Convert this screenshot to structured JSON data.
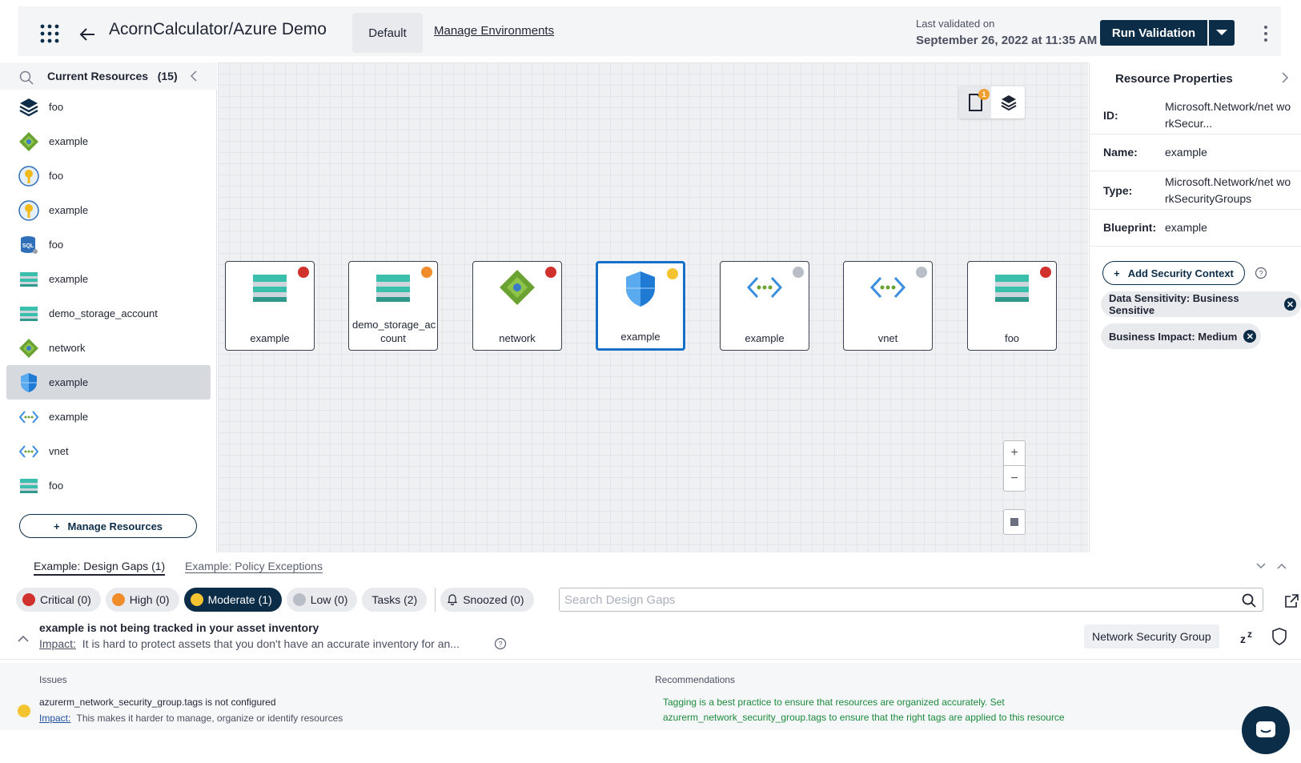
{
  "header": {
    "title": "AcornCalculator/Azure Demo",
    "env_tab": "Default",
    "manage_envs": "Manage Environments",
    "last_validated_label": "Last validated on",
    "last_validated_date": "September 26, 2022 at 11:35 AM",
    "run_validation": "Run Validation"
  },
  "sidebar": {
    "title": "Current Resources",
    "count": "(15)",
    "items": [
      {
        "label": "foo",
        "icon": "layers-icon"
      },
      {
        "label": "example",
        "icon": "network-diamond-icon"
      },
      {
        "label": "foo",
        "icon": "key-vault-icon"
      },
      {
        "label": "example",
        "icon": "key-vault-icon"
      },
      {
        "label": "foo",
        "icon": "sql-icon"
      },
      {
        "label": "example",
        "icon": "storage-icon"
      },
      {
        "label": "demo_storage_account",
        "icon": "storage-icon"
      },
      {
        "label": "network",
        "icon": "network-diamond-icon"
      },
      {
        "label": "example",
        "icon": "shield-icon",
        "active": true
      },
      {
        "label": "example",
        "icon": "vnet-icon"
      },
      {
        "label": "vnet",
        "icon": "vnet-icon"
      },
      {
        "label": "foo",
        "icon": "storage-icon"
      }
    ],
    "manage_resources": "Manage Resources"
  },
  "canvas": {
    "notification_count": "1",
    "nodes": [
      {
        "label": "example",
        "icon": "storage-icon",
        "status": "critical"
      },
      {
        "label": "demo_storage_ac count",
        "icon": "storage-icon",
        "status": "high"
      },
      {
        "label": "network",
        "icon": "network-diamond-icon",
        "status": "critical"
      },
      {
        "label": "example",
        "icon": "shield-icon",
        "status": "moderate",
        "selected": true
      },
      {
        "label": "example",
        "icon": "vnet-icon",
        "status": "low"
      },
      {
        "label": "vnet",
        "icon": "vnet-icon",
        "status": "low"
      },
      {
        "label": "foo",
        "icon": "storage-icon",
        "status": "critical"
      }
    ],
    "zoom_in": "+",
    "zoom_out": "−"
  },
  "properties": {
    "title": "Resource Properties",
    "id_label": "ID:",
    "id_value": "Microsoft.Network/net workSecur...",
    "name_label": "Name:",
    "name_value": "example",
    "type_label": "Type:",
    "type_value": "Microsoft.Network/net workSecurityGroups",
    "blueprint_label": "Blueprint:",
    "blueprint_value": "example",
    "add_context": "Add Security Context",
    "chips": [
      "Data Sensitivity: Business Sensitive",
      "Business Impact: Medium"
    ]
  },
  "bottom": {
    "tab_gaps": "Example: Design Gaps (1)",
    "tab_exceptions": "Example: Policy Exceptions",
    "filters": {
      "critical": "Critical (0)",
      "high": "High (0)",
      "moderate": "Moderate (1)",
      "low": "Low (0)",
      "tasks": "Tasks (2)",
      "snoozed": "Snoozed (0)"
    },
    "search_placeholder": "Search Design Gaps",
    "gap": {
      "title": "example is not being tracked in your asset inventory",
      "impact_label": "Impact:",
      "impact_text": "It is hard to protect assets that you don't have an accurate inventory for an...",
      "tag": "Network Security Group"
    },
    "detail": {
      "issues_head": "Issues",
      "recs_head": "Recommendations",
      "issue_text": "azurerm_network_security_group.tags is not configured",
      "issue_impact_label": "Impact:",
      "issue_impact_text": "This makes it harder to manage, organize or identify resources",
      "rec_line1": "Tagging is a best practice to ensure that resources are organized accurately. Set",
      "rec_line2": "azurerm_network_security_group.tags to ensure that the right tags are applied to this resource"
    }
  },
  "colors": {
    "navy": "#0c2d48",
    "critical": "#d0312d",
    "high": "#f08c2a",
    "moderate": "#f4c430",
    "low": "#b8bdc6",
    "recommendation": "#1c8a3c"
  }
}
